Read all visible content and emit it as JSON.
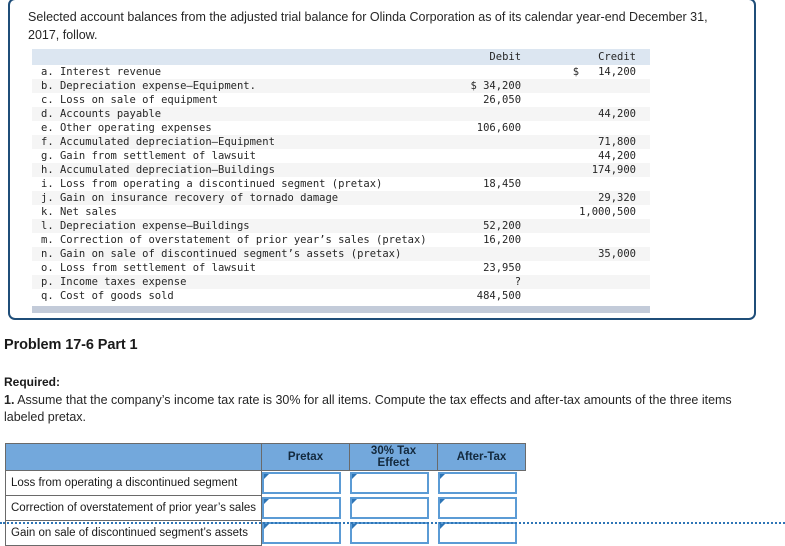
{
  "intro": {
    "text": "Selected account balances from the adjusted trial balance for Olinda Corporation as of its calendar year-end December 31, 2017, follow."
  },
  "trial_balance": {
    "columns": [
      "",
      "Debit",
      "Credit"
    ],
    "rows": [
      {
        "name": "a. Interest revenue",
        "debit": "",
        "credit": "$   14,200"
      },
      {
        "name": "b. Depreciation expense—Equipment.",
        "debit": "$ 34,200",
        "credit": ""
      },
      {
        "name": "c. Loss on sale of equipment",
        "debit": "26,050",
        "credit": ""
      },
      {
        "name": "d. Accounts payable",
        "debit": "",
        "credit": "44,200"
      },
      {
        "name": "e. Other operating expenses",
        "debit": "106,600",
        "credit": ""
      },
      {
        "name": "f. Accumulated depreciation—Equipment",
        "debit": "",
        "credit": "71,800"
      },
      {
        "name": "g. Gain from settlement of lawsuit",
        "debit": "",
        "credit": "44,200"
      },
      {
        "name": "h. Accumulated depreciation—Buildings",
        "debit": "",
        "credit": "174,900"
      },
      {
        "name": "i. Loss from operating a discontinued segment (pretax)",
        "debit": "18,450",
        "credit": ""
      },
      {
        "name": "j. Gain on insurance recovery of tornado damage",
        "debit": "",
        "credit": "29,320"
      },
      {
        "name": "k. Net sales",
        "debit": "",
        "credit": "1,000,500"
      },
      {
        "name": "l. Depreciation expense—Buildings",
        "debit": "52,200",
        "credit": ""
      },
      {
        "name": "m. Correction of overstatement of prior year’s sales (pretax)",
        "debit": "16,200",
        "credit": ""
      },
      {
        "name": "n. Gain on sale of discontinued segment’s assets (pretax)",
        "debit": "",
        "credit": "35,000"
      },
      {
        "name": "o. Loss from settlement of lawsuit",
        "debit": "23,950",
        "credit": ""
      },
      {
        "name": "p. Income taxes expense",
        "debit": "?",
        "credit": ""
      },
      {
        "name": "q. Cost of goods sold",
        "debit": "484,500",
        "credit": ""
      }
    ]
  },
  "problem": {
    "heading": "Problem 17-6 Part 1"
  },
  "required": {
    "label": "Required:",
    "number": "1.",
    "text": " Assume that the company’s income tax rate is 30% for all items. Compute the tax effects and after-tax amounts of the three items labeled pretax."
  },
  "answer_table": {
    "corner_header": "",
    "headers": [
      "Pretax",
      "30% Tax Effect",
      "After-Tax"
    ],
    "rows": [
      {
        "label": "Loss from operating a discontinued segment",
        "pretax": "",
        "tax_effect": "",
        "after_tax": ""
      },
      {
        "label": "Correction of overstatement of prior year’s sales",
        "pretax": "",
        "tax_effect": "",
        "after_tax": ""
      },
      {
        "label": "Gain on sale of discontinued segment’s assets",
        "pretax": "",
        "tax_effect": "",
        "after_tax": ""
      }
    ]
  },
  "colors": {
    "card_border": "#1f4e79",
    "tb_header_bg": "#dce6f1",
    "tb_footer_bar": "#c3cbd9",
    "answer_header_bg": "#73a8dc",
    "input_border": "#5b9bd5",
    "dotted_rule": "#2e75b6"
  }
}
